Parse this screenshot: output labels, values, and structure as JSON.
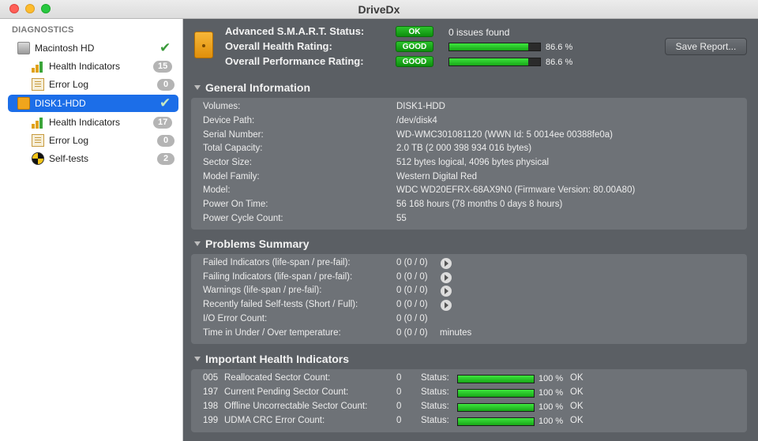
{
  "window": {
    "title": "DriveDx"
  },
  "sidebar": {
    "heading": "DIAGNOSTICS",
    "items": [
      {
        "label": "Macintosh HD",
        "check": "✔"
      },
      {
        "label": "Health Indicators",
        "badge": "15"
      },
      {
        "label": "Error Log",
        "badge": "0"
      },
      {
        "label": "DISK1-HDD",
        "check": "✔"
      },
      {
        "label": "Health Indicators",
        "badge": "17"
      },
      {
        "label": "Error Log",
        "badge": "0"
      },
      {
        "label": "Self-tests",
        "badge": "2"
      }
    ]
  },
  "status": {
    "smart": {
      "label": "Advanced S.M.A.R.T. Status:",
      "pill": "OK",
      "text": "0 issues found"
    },
    "health": {
      "label": "Overall Health Rating:",
      "pill": "GOOD",
      "percent": "86.6 %",
      "level": 0.866
    },
    "performance": {
      "label": "Overall Performance Rating:",
      "pill": "GOOD",
      "percent": "86.6 %",
      "level": 0.866
    },
    "save_label": "Save Report..."
  },
  "general": {
    "title": "General Information",
    "rows": [
      {
        "k": "Volumes:",
        "v": "DISK1-HDD"
      },
      {
        "k": "Device Path:",
        "v": "/dev/disk4"
      },
      {
        "k": "Serial Number:",
        "v": "WD-WMC301081120 (WWN Id: 5 0014ee 00388fe0a)"
      },
      {
        "k": "Total Capacity:",
        "v": "2.0 TB (2 000 398 934 016 bytes)"
      },
      {
        "k": "Sector Size:",
        "v": "512 bytes logical, 4096 bytes physical"
      },
      {
        "k": "Model Family:",
        "v": "Western Digital Red"
      },
      {
        "k": "Model:",
        "v": "WDC WD20EFRX-68AX9N0  (Firmware Version: 80.00A80)"
      },
      {
        "k": "Power On Time:",
        "v": "56 168 hours (78 months 0 days 8 hours)"
      },
      {
        "k": "Power Cycle Count:",
        "v": "55"
      }
    ]
  },
  "problems": {
    "title": "Problems Summary",
    "rows": [
      {
        "k": "Failed Indicators (life-span / pre-fail):",
        "v": "0 (0 / 0)"
      },
      {
        "k": "Failing Indicators (life-span / pre-fail):",
        "v": "0 (0 / 0)"
      },
      {
        "k": "Warnings (life-span / pre-fail):",
        "v": "0 (0 / 0)"
      },
      {
        "k": "Recently failed Self-tests (Short / Full):",
        "v": "0 (0 / 0)"
      },
      {
        "k": "I/O Error Count:",
        "v": "0 (0 / 0)"
      },
      {
        "k": "Time in Under / Over temperature:",
        "v": "0 (0 / 0)",
        "unit": "minutes"
      }
    ]
  },
  "health": {
    "title": "Important Health Indicators",
    "status_label": "Status:",
    "rows": [
      {
        "id": "005",
        "name": "Reallocated Sector Count:",
        "value": "0",
        "percent": "100 %",
        "level": 1.0,
        "state": "OK"
      },
      {
        "id": "197",
        "name": "Current Pending Sector Count:",
        "value": "0",
        "percent": "100 %",
        "level": 1.0,
        "state": "OK"
      },
      {
        "id": "198",
        "name": "Offline Uncorrectable Sector Count:",
        "value": "0",
        "percent": "100 %",
        "level": 1.0,
        "state": "OK"
      },
      {
        "id": "199",
        "name": "UDMA CRC Error Count:",
        "value": "0",
        "percent": "100 %",
        "level": 1.0,
        "state": "OK"
      }
    ]
  }
}
